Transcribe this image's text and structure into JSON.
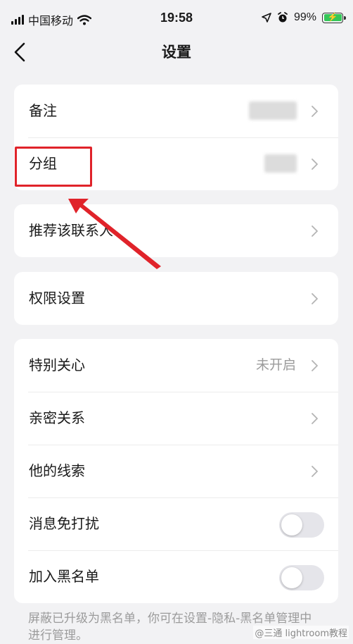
{
  "status_bar": {
    "carrier": "中国移动",
    "time": "19:58",
    "battery_level": "99%"
  },
  "nav": {
    "title": "设置",
    "back_icon": "chevron-left-icon"
  },
  "sections": {
    "group1": [
      {
        "label": "备注",
        "value_blurred": true
      },
      {
        "label": "分组",
        "value_blurred": true
      }
    ],
    "group2": [
      {
        "label": "推荐该联系人"
      }
    ],
    "group3": [
      {
        "label": "权限设置"
      }
    ],
    "group4": [
      {
        "label": "特别关心",
        "value": "未开启"
      },
      {
        "label": "亲密关系"
      },
      {
        "label": "他的线索"
      },
      {
        "label": "消息免打扰",
        "toggle": false
      },
      {
        "label": "加入黑名单",
        "toggle": false
      }
    ]
  },
  "footer_note": "屏蔽已升级为黑名单，你可在设置-隐私-黑名单管理中进行管理。",
  "watermark": "@三通 lightroom教程",
  "colors": {
    "background": "#f2f2f4",
    "card": "#ffffff",
    "annotation": "#e0232a",
    "toggle_off": "#e5e5ea",
    "battery": "#35c759"
  }
}
